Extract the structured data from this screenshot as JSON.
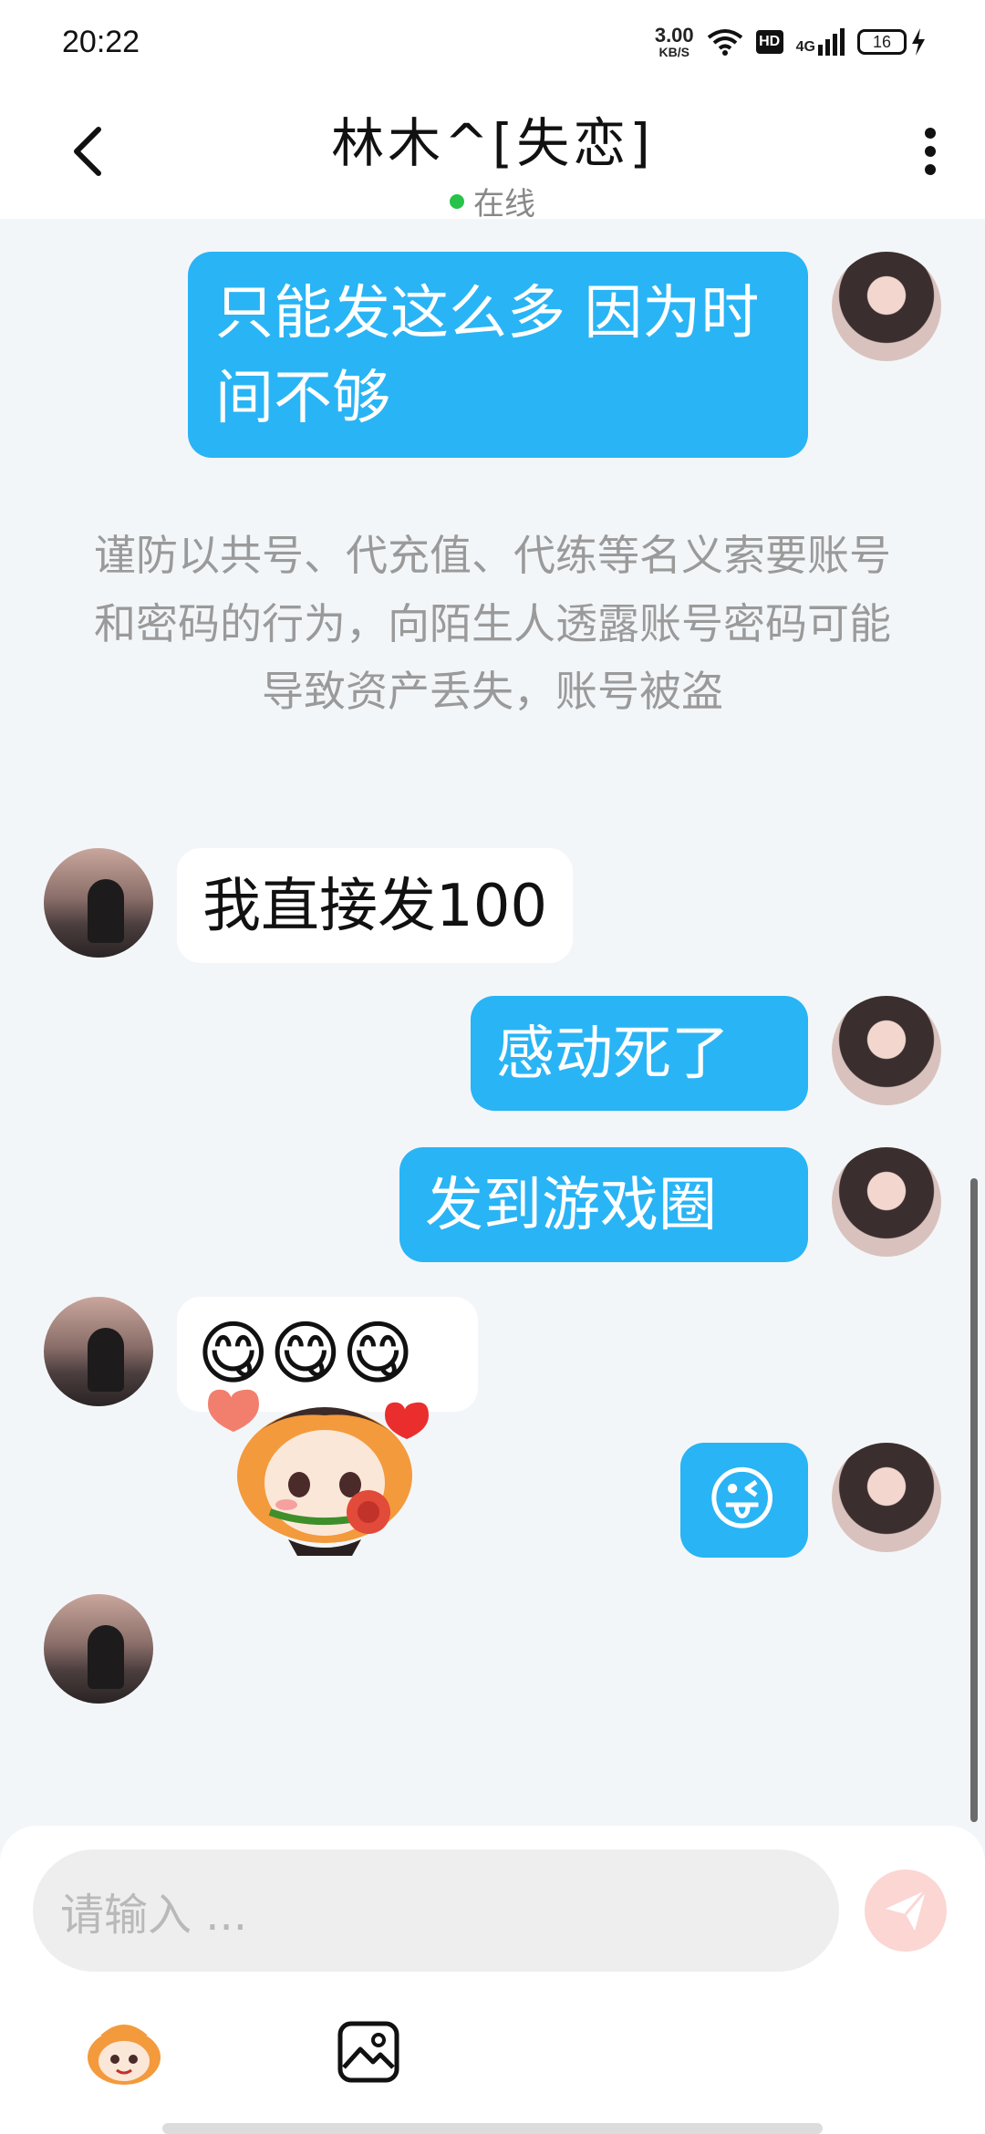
{
  "status_bar": {
    "time": "20:22",
    "speed_value": "3.00",
    "speed_unit": "KB/S",
    "hd": "HD",
    "network": "4G",
    "battery": "16"
  },
  "header": {
    "title": "林木^[失恋]",
    "status": "在线"
  },
  "messages": {
    "m1": "只能发这么多 因为时间不够",
    "notice": "谨防以共号、代充值、代练等名义索要账号和密码的行为，向陌生人透露账号密码可能导致资产丢失，账号被盗",
    "m2": "我直接发100",
    "m3": "感动死了",
    "m4": "发到游戏圈",
    "m5": "😋😋😋",
    "m6": "😜"
  },
  "input": {
    "placeholder": "请输入 ..."
  },
  "colors": {
    "accent": "#29b4f5",
    "online": "#27c24a",
    "send_disabled": "#fbd6d3"
  }
}
